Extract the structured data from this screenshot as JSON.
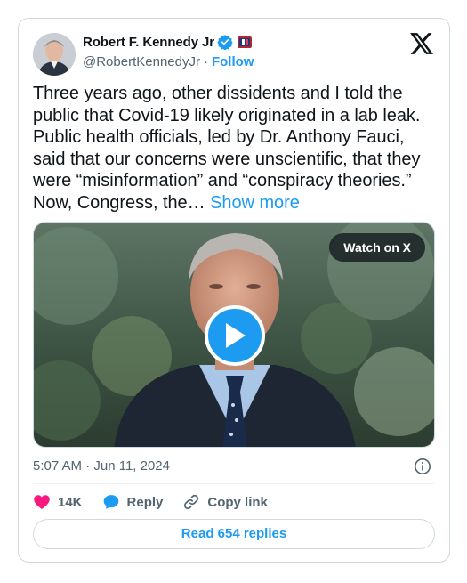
{
  "author": {
    "name": "Robert F. Kennedy Jr",
    "handle": "@RobertKennedyJr",
    "separator": "·",
    "follow_label": "Follow",
    "verified_icon": "verified-badge-icon",
    "affiliation_icon": "flag-icon"
  },
  "tweet": {
    "text": "Three years ago, other dissidents and I told the public that Covid-19 likely originated in a lab leak. Public health officials, led by Dr. Anthony Fauci, said that our concerns were unscientific, that they were “misinformation” and “conspiracy theories.” Now, Congress, the…",
    "show_more_label": "Show more"
  },
  "media": {
    "watch_label": "Watch on X",
    "play_icon": "play-icon"
  },
  "meta": {
    "timestamp": "5:07 AM · Jun 11, 2024",
    "info_icon": "info-icon"
  },
  "actions": {
    "like_count": "14K",
    "reply_label": "Reply",
    "copy_link_label": "Copy link"
  },
  "read_replies_label": "Read 654 replies",
  "colors": {
    "accent": "#1d9bf0",
    "like": "#f91880",
    "text": "#0f1419",
    "muted": "#536471",
    "border": "#cfd9de"
  }
}
